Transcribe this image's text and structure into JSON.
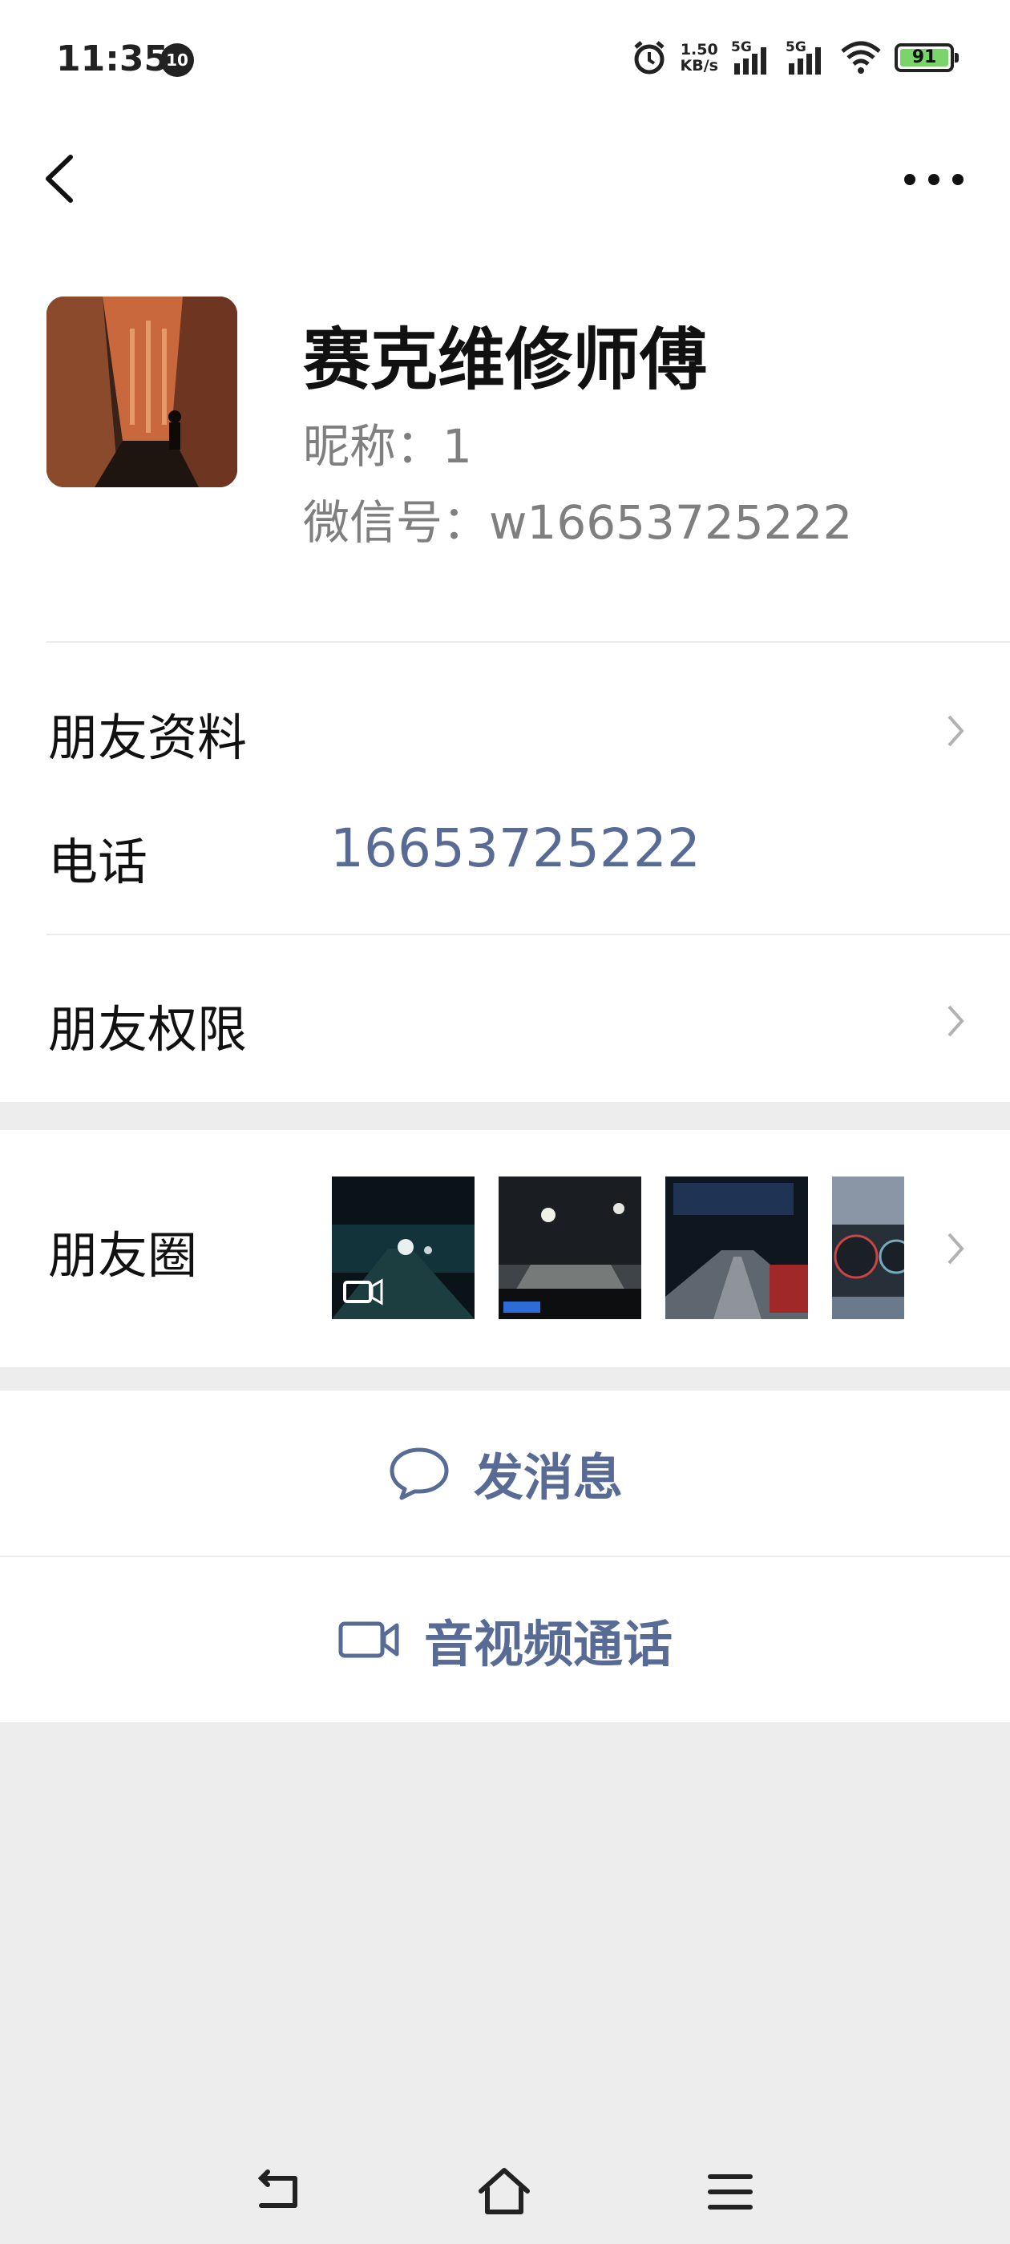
{
  "status_bar": {
    "time": "11:35",
    "notification_count": "10",
    "net_speed_value": "1.50",
    "net_speed_unit": "KB/s",
    "sim1_label": "5G",
    "sim2_label": "5G",
    "battery_level": "91"
  },
  "profile": {
    "name": "赛克维修师傅",
    "nickname": "昵称：1",
    "wechat_id": "微信号：w16653725222"
  },
  "rows": {
    "friend_info": "朋友资料",
    "phone_label": "电话",
    "phone_number": "16653725222",
    "friend_permissions": "朋友权限",
    "moments": "朋友圈"
  },
  "actions": {
    "send_message": "发消息",
    "av_call": "音视频通话"
  },
  "colors": {
    "link": "#576b95",
    "background": "#ededed"
  }
}
